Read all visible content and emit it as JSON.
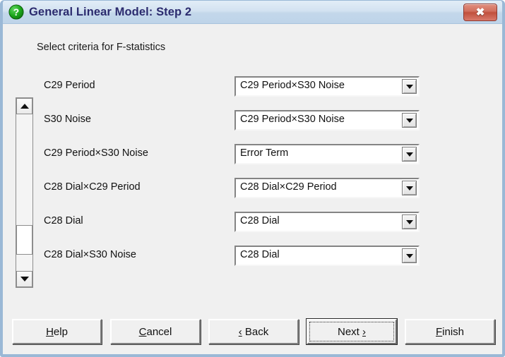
{
  "window": {
    "title": "General Linear Model: Step 2",
    "icon": "help-question-icon",
    "close_label": "✖"
  },
  "dialog": {
    "instruction": "Select criteria for F-statistics"
  },
  "scrollbar": {
    "up_icon": "scroll-up-arrow-icon",
    "down_icon": "scroll-down-arrow-icon",
    "thumb_name": "scrollbar-thumb"
  },
  "rows": [
    {
      "label": "C29 Period",
      "value": "C29 Period×S30 Noise",
      "arrow_icon": "chevron-down-icon"
    },
    {
      "label": "S30 Noise",
      "value": "C29 Period×S30 Noise",
      "arrow_icon": "chevron-down-icon"
    },
    {
      "label": "C29 Period×S30 Noise",
      "value": "Error Term",
      "arrow_icon": "chevron-down-icon"
    },
    {
      "label": "C28 Dial×C29 Period",
      "value": "C28 Dial×C29 Period",
      "arrow_icon": "chevron-down-icon"
    },
    {
      "label": "C28 Dial",
      "value": "C28 Dial",
      "arrow_icon": "chevron-down-icon"
    },
    {
      "label": "C28 Dial×S30 Noise",
      "value": "C28 Dial",
      "arrow_icon": "chevron-down-icon"
    }
  ],
  "buttons": {
    "help": {
      "pre": "",
      "acc": "H",
      "post": "elp"
    },
    "cancel": {
      "pre": "",
      "acc": "C",
      "post": "ancel"
    },
    "back": {
      "pre": "",
      "acc": "‹",
      "post": " Back"
    },
    "next": {
      "pre": "Next ",
      "acc": "›",
      "post": ""
    },
    "finish": {
      "pre": "",
      "acc": "F",
      "post": "inish"
    }
  },
  "colors": {
    "titlebar_start": "#e2edf7",
    "titlebar_end": "#bed4e9",
    "title_text": "#2b2b6e",
    "dialog_bg": "#f0f0f0",
    "window_border": "#9ab8d6",
    "close_red": "#c0503d",
    "icon_green": "#1f9b1f"
  }
}
